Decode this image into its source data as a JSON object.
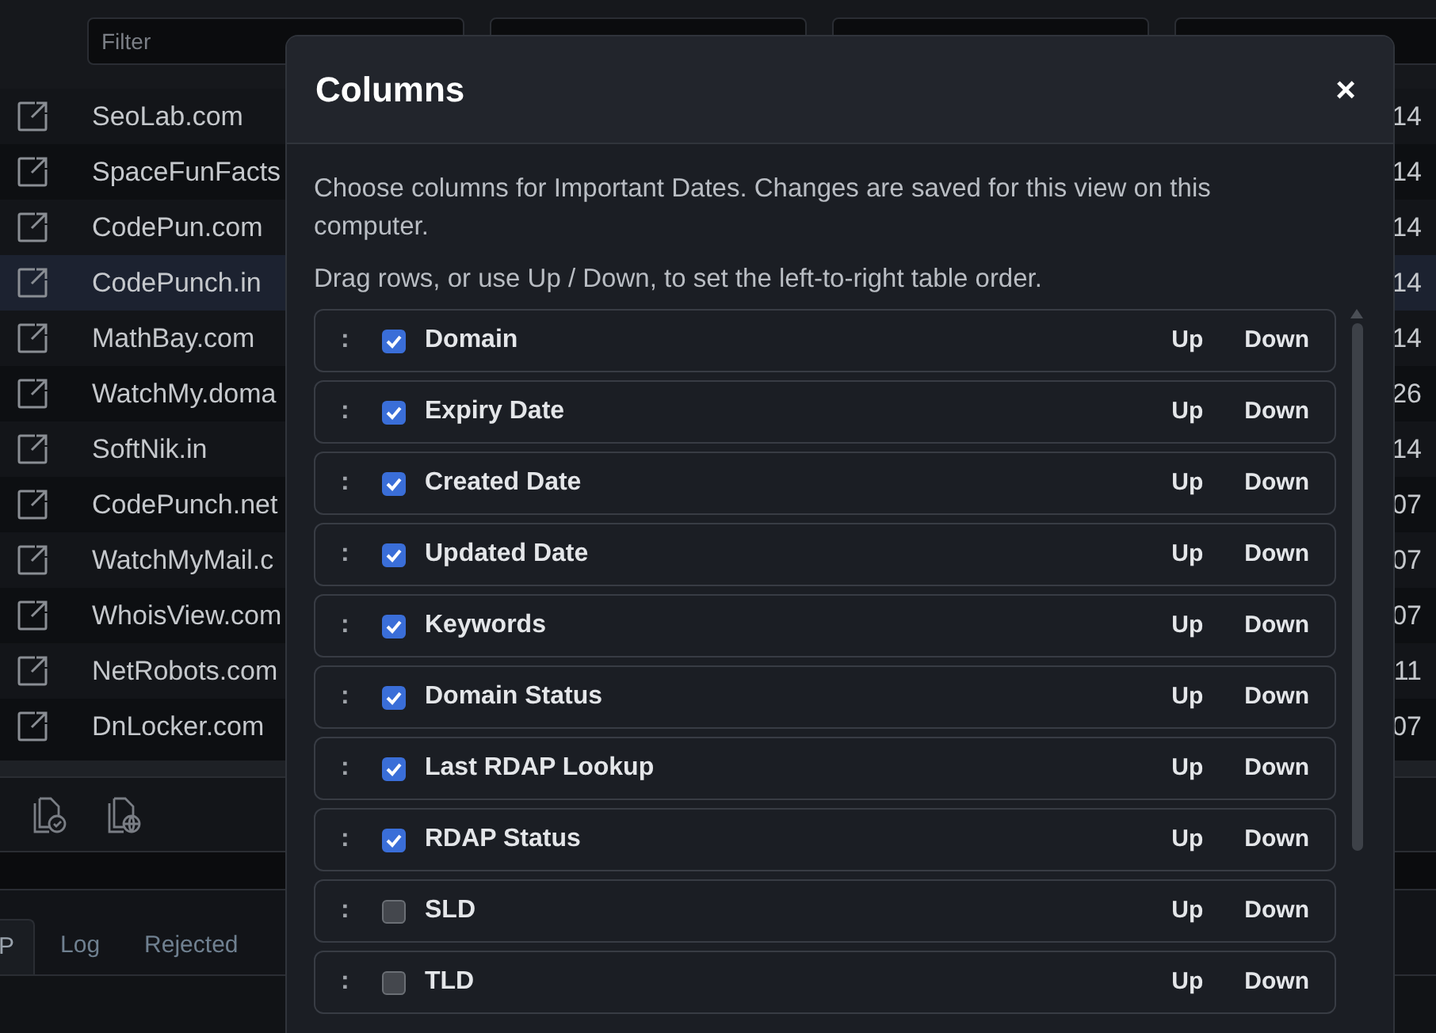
{
  "table": {
    "filter": {
      "placeholder": "Filter"
    },
    "rows": [
      {
        "domain": "SeoLab.com",
        "date": "14",
        "hover": false
      },
      {
        "domain": "SpaceFunFacts",
        "date": "14",
        "hover": false
      },
      {
        "domain": "CodePun.com",
        "date": "14",
        "hover": false
      },
      {
        "domain": "CodePunch.in",
        "date": "14",
        "hover": true
      },
      {
        "domain": "MathBay.com",
        "date": "14",
        "hover": false
      },
      {
        "domain": "WatchMy.doma",
        "date": "26",
        "hover": false
      },
      {
        "domain": "SoftNik.in",
        "date": "14",
        "hover": false
      },
      {
        "domain": "CodePunch.net",
        "date": "07",
        "hover": false
      },
      {
        "domain": "WatchMyMail.c",
        "date": "07",
        "hover": false
      },
      {
        "domain": "WhoisView.com",
        "date": "07",
        "hover": false
      },
      {
        "domain": "NetRobots.com",
        "date": "11",
        "hover": false
      },
      {
        "domain": "DnLocker.com",
        "date": "07",
        "hover": false
      }
    ]
  },
  "bottom_tabs": [
    {
      "label": "P",
      "selected": true
    },
    {
      "label": "Log",
      "selected": false
    },
    {
      "label": "Rejected",
      "selected": false
    }
  ],
  "dialog": {
    "title": "Columns",
    "close": "×",
    "description": "Choose columns for Important Dates. Changes are saved for this view on this computer.",
    "hint": "Drag rows, or use Up / Down, to set the left-to-right table order.",
    "columns": [
      {
        "label": "Domain",
        "checked": true,
        "handle": ":",
        "up": "Up",
        "down": "Down"
      },
      {
        "label": "Expiry Date",
        "checked": true,
        "handle": ":",
        "up": "Up",
        "down": "Down"
      },
      {
        "label": "Created Date",
        "checked": true,
        "handle": ":",
        "up": "Up",
        "down": "Down"
      },
      {
        "label": "Updated Date",
        "checked": true,
        "handle": ":",
        "up": "Up",
        "down": "Down"
      },
      {
        "label": "Keywords",
        "checked": true,
        "handle": ":",
        "up": "Up",
        "down": "Down"
      },
      {
        "label": "Domain Status",
        "checked": true,
        "handle": ":",
        "up": "Up",
        "down": "Down"
      },
      {
        "label": "Last RDAP Lookup",
        "checked": true,
        "handle": ":",
        "up": "Up",
        "down": "Down"
      },
      {
        "label": "RDAP Status",
        "checked": true,
        "handle": ":",
        "up": "Up",
        "down": "Down"
      },
      {
        "label": "SLD",
        "checked": false,
        "handle": ":",
        "up": "Up",
        "down": "Down"
      },
      {
        "label": "TLD",
        "checked": false,
        "handle": ":",
        "up": "Up",
        "down": "Down"
      }
    ]
  }
}
